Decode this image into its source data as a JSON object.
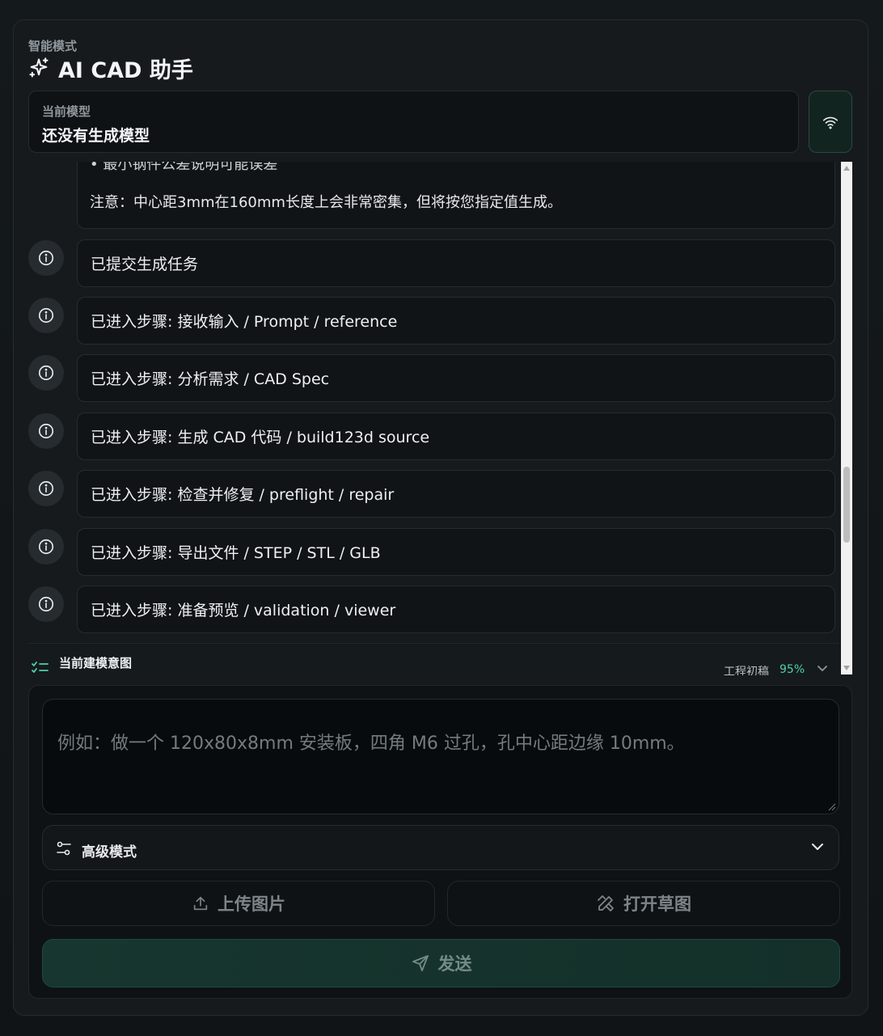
{
  "header": {
    "mode_label": "智能模式",
    "title": "AI CAD 助手"
  },
  "model": {
    "label": "当前模型",
    "value": "还没有生成模型"
  },
  "chat": {
    "first_message": {
      "partial_line": "• 最小钢件公差说明可能误差",
      "note": "注意：中心距3mm在160mm长度上会非常密集，但将按您指定值生成。"
    },
    "messages": [
      "已提交生成任务",
      "已进入步骤: 接收输入 / Prompt / reference",
      "已进入步骤: 分析需求 / CAD Spec",
      "已进入步骤: 生成 CAD 代码 / build123d source",
      "已进入步骤: 检查并修复 / preflight / repair",
      "已进入步骤: 导出文件 / STEP / STL / GLB",
      "已进入步骤: 准备预览 / validation / viewer"
    ]
  },
  "sketch_panel": {
    "title": "当前建模意图",
    "stage": "工程初稿",
    "percent": "95%"
  },
  "composer": {
    "placeholder": "例如：做一个 120x80x8mm 安装板，四角 M6 过孔，孔中心距边缘 10mm。",
    "advanced_label": "高级模式",
    "upload_label": "上传图片",
    "sketch_label": "打开草图",
    "send_label": "发送"
  },
  "colors": {
    "accent": "#4fd1a5",
    "background": "#111416",
    "send_button": "#16362f"
  }
}
